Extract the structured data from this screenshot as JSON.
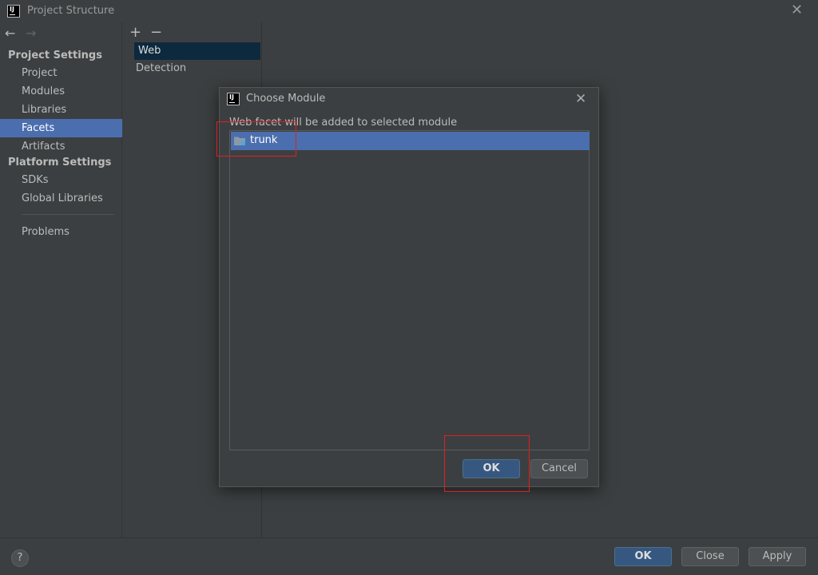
{
  "window": {
    "title": "Project Structure",
    "logo_text": "IJ"
  },
  "nav": {
    "back_glyph": "←",
    "forward_glyph": "→"
  },
  "sidebar": {
    "project_settings_heading": "Project Settings",
    "project_items": [
      {
        "label": "Project"
      },
      {
        "label": "Modules"
      },
      {
        "label": "Libraries"
      },
      {
        "label": "Facets",
        "active": true
      },
      {
        "label": "Artifacts"
      }
    ],
    "platform_settings_heading": "Platform Settings",
    "platform_items": [
      {
        "label": "SDKs"
      },
      {
        "label": "Global Libraries"
      }
    ],
    "problems_label": "Problems"
  },
  "facet_panel": {
    "add_glyph": "+",
    "remove_glyph": "−",
    "items": [
      {
        "label": "Web",
        "selected": true
      },
      {
        "label": "Detection"
      }
    ]
  },
  "dialog": {
    "title": "Choose Module",
    "logo_text": "IJ",
    "description": "Web facet will be added to selected module",
    "modules": [
      {
        "label": "trunk",
        "selected": true
      }
    ],
    "ok_label": "OK",
    "cancel_label": "Cancel"
  },
  "bottom": {
    "help_glyph": "?",
    "ok_label": "OK",
    "close_label": "Close",
    "apply_label": "Apply"
  },
  "colors": {
    "background": "#3c3f41",
    "selection": "#4b6eaf",
    "primary_button": "#365880",
    "highlight_annotation": "#e02020"
  }
}
